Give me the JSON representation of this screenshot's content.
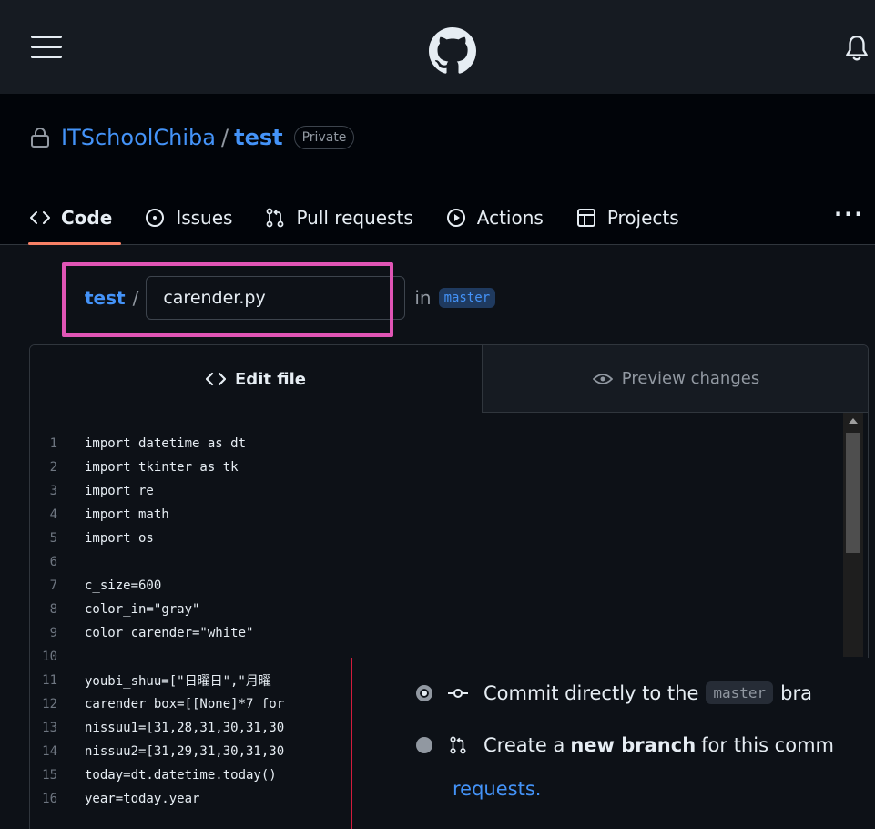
{
  "header": {
    "menu_icon": "hamburger-icon",
    "logo_icon": "github-logo-icon",
    "notification_icon": "bell-icon"
  },
  "repo": {
    "owner": "ITSchoolChiba",
    "separator": "/",
    "name": "test",
    "visibility": "Private"
  },
  "tabs": [
    {
      "label": "Code",
      "icon": "code-icon",
      "active": true
    },
    {
      "label": "Issues",
      "icon": "issue-circle-icon"
    },
    {
      "label": "Pull requests",
      "icon": "pull-request-icon"
    },
    {
      "label": "Actions",
      "icon": "play-icon"
    },
    {
      "label": "Projects",
      "icon": "table-icon"
    }
  ],
  "more_label": "···",
  "path": {
    "repo": "test",
    "separator": "/",
    "filename": "carender.py",
    "in_label": "in",
    "branch": "master"
  },
  "editor": {
    "edit_tab": "Edit file",
    "preview_tab": "Preview changes",
    "lines": [
      {
        "n": "1",
        "code": "import datetime as dt"
      },
      {
        "n": "2",
        "code": "import tkinter as tk"
      },
      {
        "n": "3",
        "code": "import re"
      },
      {
        "n": "4",
        "code": "import math"
      },
      {
        "n": "5",
        "code": "import os"
      },
      {
        "n": "6",
        "code": ""
      },
      {
        "n": "7",
        "code": "c_size=600"
      },
      {
        "n": "8",
        "code": "color_in=\"gray\""
      },
      {
        "n": "9",
        "code": "color_carender=\"white\""
      },
      {
        "n": "10",
        "code": ""
      },
      {
        "n": "11",
        "code": "youbi_shuu=[\"日曜日\",\"月曜"
      },
      {
        "n": "12",
        "code": "carender_box=[[None]*7 for"
      },
      {
        "n": "13",
        "code": "nissuu1=[31,28,31,30,31,30"
      },
      {
        "n": "14",
        "code": "nissuu2=[31,29,31,30,31,30"
      },
      {
        "n": "15",
        "code": "today=dt.datetime.today()"
      },
      {
        "n": "16",
        "code": "year=today.year"
      }
    ]
  },
  "commit": {
    "option1_prefix": "Commit directly to the",
    "option1_branch": "master",
    "option1_suffix": "bra",
    "option2_prefix": "Create a",
    "option2_bold": "new branch",
    "option2_suffix": "for this comm",
    "option2_link": "requests."
  }
}
